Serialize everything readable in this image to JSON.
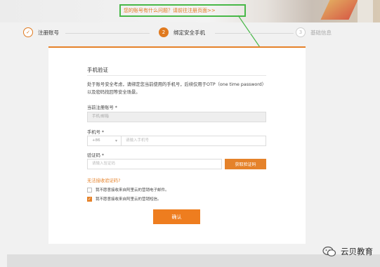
{
  "banner": {
    "notice_link": "您的账号有什么问题？请前往注册页面>>"
  },
  "steps": [
    {
      "number": "✓",
      "label": "注册账号",
      "state": "done"
    },
    {
      "number": "2",
      "label": "绑定安全手机",
      "state": "active"
    },
    {
      "number": "3",
      "label": "基础信息",
      "state": "todo"
    }
  ],
  "form": {
    "title": "手机验证",
    "description": "处于账号安全考虑，请绑定您当前使用的手机号，后续仅用于OTP（one time password）以及密码找回等安全场景。",
    "account_label": "当前注册账号 *",
    "account_value": "手机/邮箱",
    "phone_label": "手机号 *",
    "phone_prefix": "+86",
    "phone_placeholder": "请输入手机号",
    "code_label": "验证码 *",
    "code_placeholder": "请输入验证码",
    "get_code_button": "获取验证码",
    "help_link": "无法接收验证码?",
    "checkbox_1_label": "我不愿意接收来自阿里云的营销电子邮件。",
    "checkbox_1_checked": false,
    "checkbox_2_label": "我不愿意接收来自阿里云的营销短信。",
    "checkbox_2_checked": true,
    "confirm_button": "确认"
  },
  "watermark": {
    "text": "云贝教育"
  },
  "colors": {
    "accent": "#e5822a",
    "highlight_box": "#48b848"
  }
}
